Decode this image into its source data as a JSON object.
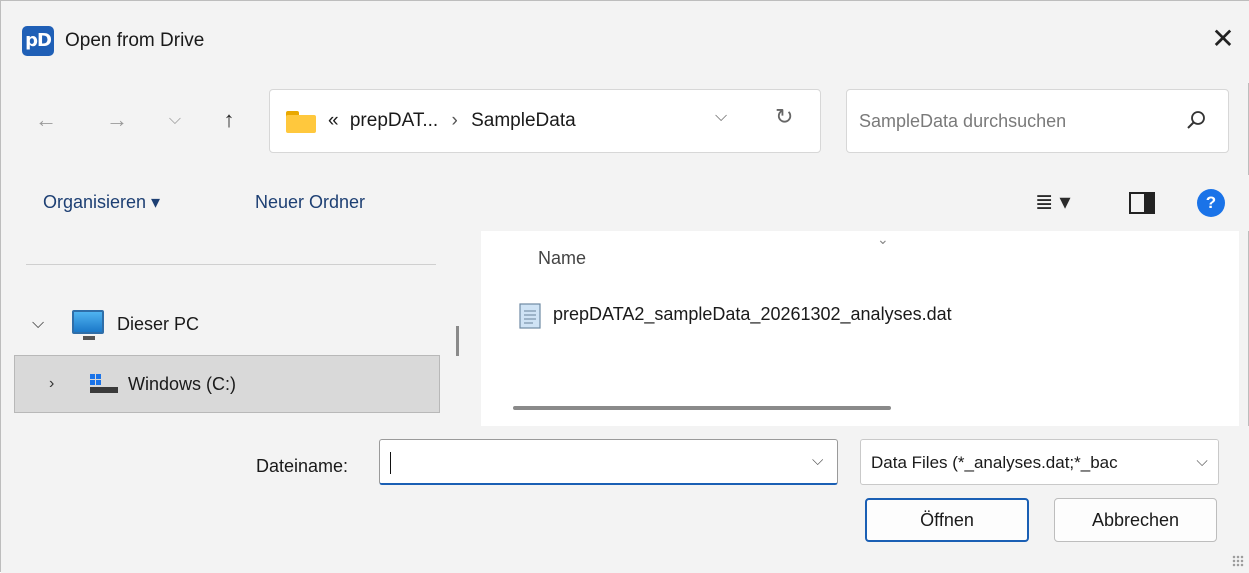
{
  "window": {
    "app_icon_text": "pD",
    "title": "Open from Drive",
    "close_glyph": "✕"
  },
  "navigation": {
    "back_glyph": "←",
    "forward_glyph": "→",
    "recent_glyph": "⌵",
    "up_glyph": "↑"
  },
  "address_bar": {
    "overflow_glyph": "«",
    "crumbs": [
      "prepDAT...",
      "SampleData"
    ],
    "separator_glyph": "›",
    "dropdown_glyph": "⌵",
    "refresh_glyph": "↻"
  },
  "search": {
    "placeholder": "SampleData durchsuchen"
  },
  "toolbar": {
    "organize_label": "Organisieren ▾",
    "new_folder_label": "Neuer Ordner",
    "view_glyph": "≣ ▾",
    "help_glyph": "?"
  },
  "nav_pane": {
    "items": [
      {
        "label": "Dieser PC",
        "expanded_glyph": "⌵",
        "icon": "computer-icon"
      },
      {
        "label": "Windows  (C:)",
        "expanded_glyph": "›",
        "icon": "drive-icon",
        "selected": true
      }
    ]
  },
  "file_list": {
    "sort_glyph": "⌄",
    "column_name": "Name",
    "files": [
      {
        "name": "prepDATA2_sampleData_20261302_analyses.dat",
        "icon": "dat-file-icon"
      }
    ]
  },
  "footer": {
    "filename_label": "Dateiname:",
    "filename_value": "",
    "filename_dropdown_glyph": "⌵",
    "filter_value": "Data Files (*_analyses.dat;*_bac",
    "filter_dropdown_glyph": "⌵",
    "open_label": "Öffnen",
    "cancel_label": "Abbrechen"
  },
  "colors": {
    "accent": "#1a5fb4",
    "help": "#1a73e8",
    "folder": "#ffc83d",
    "link_text": "#1d3f73"
  }
}
